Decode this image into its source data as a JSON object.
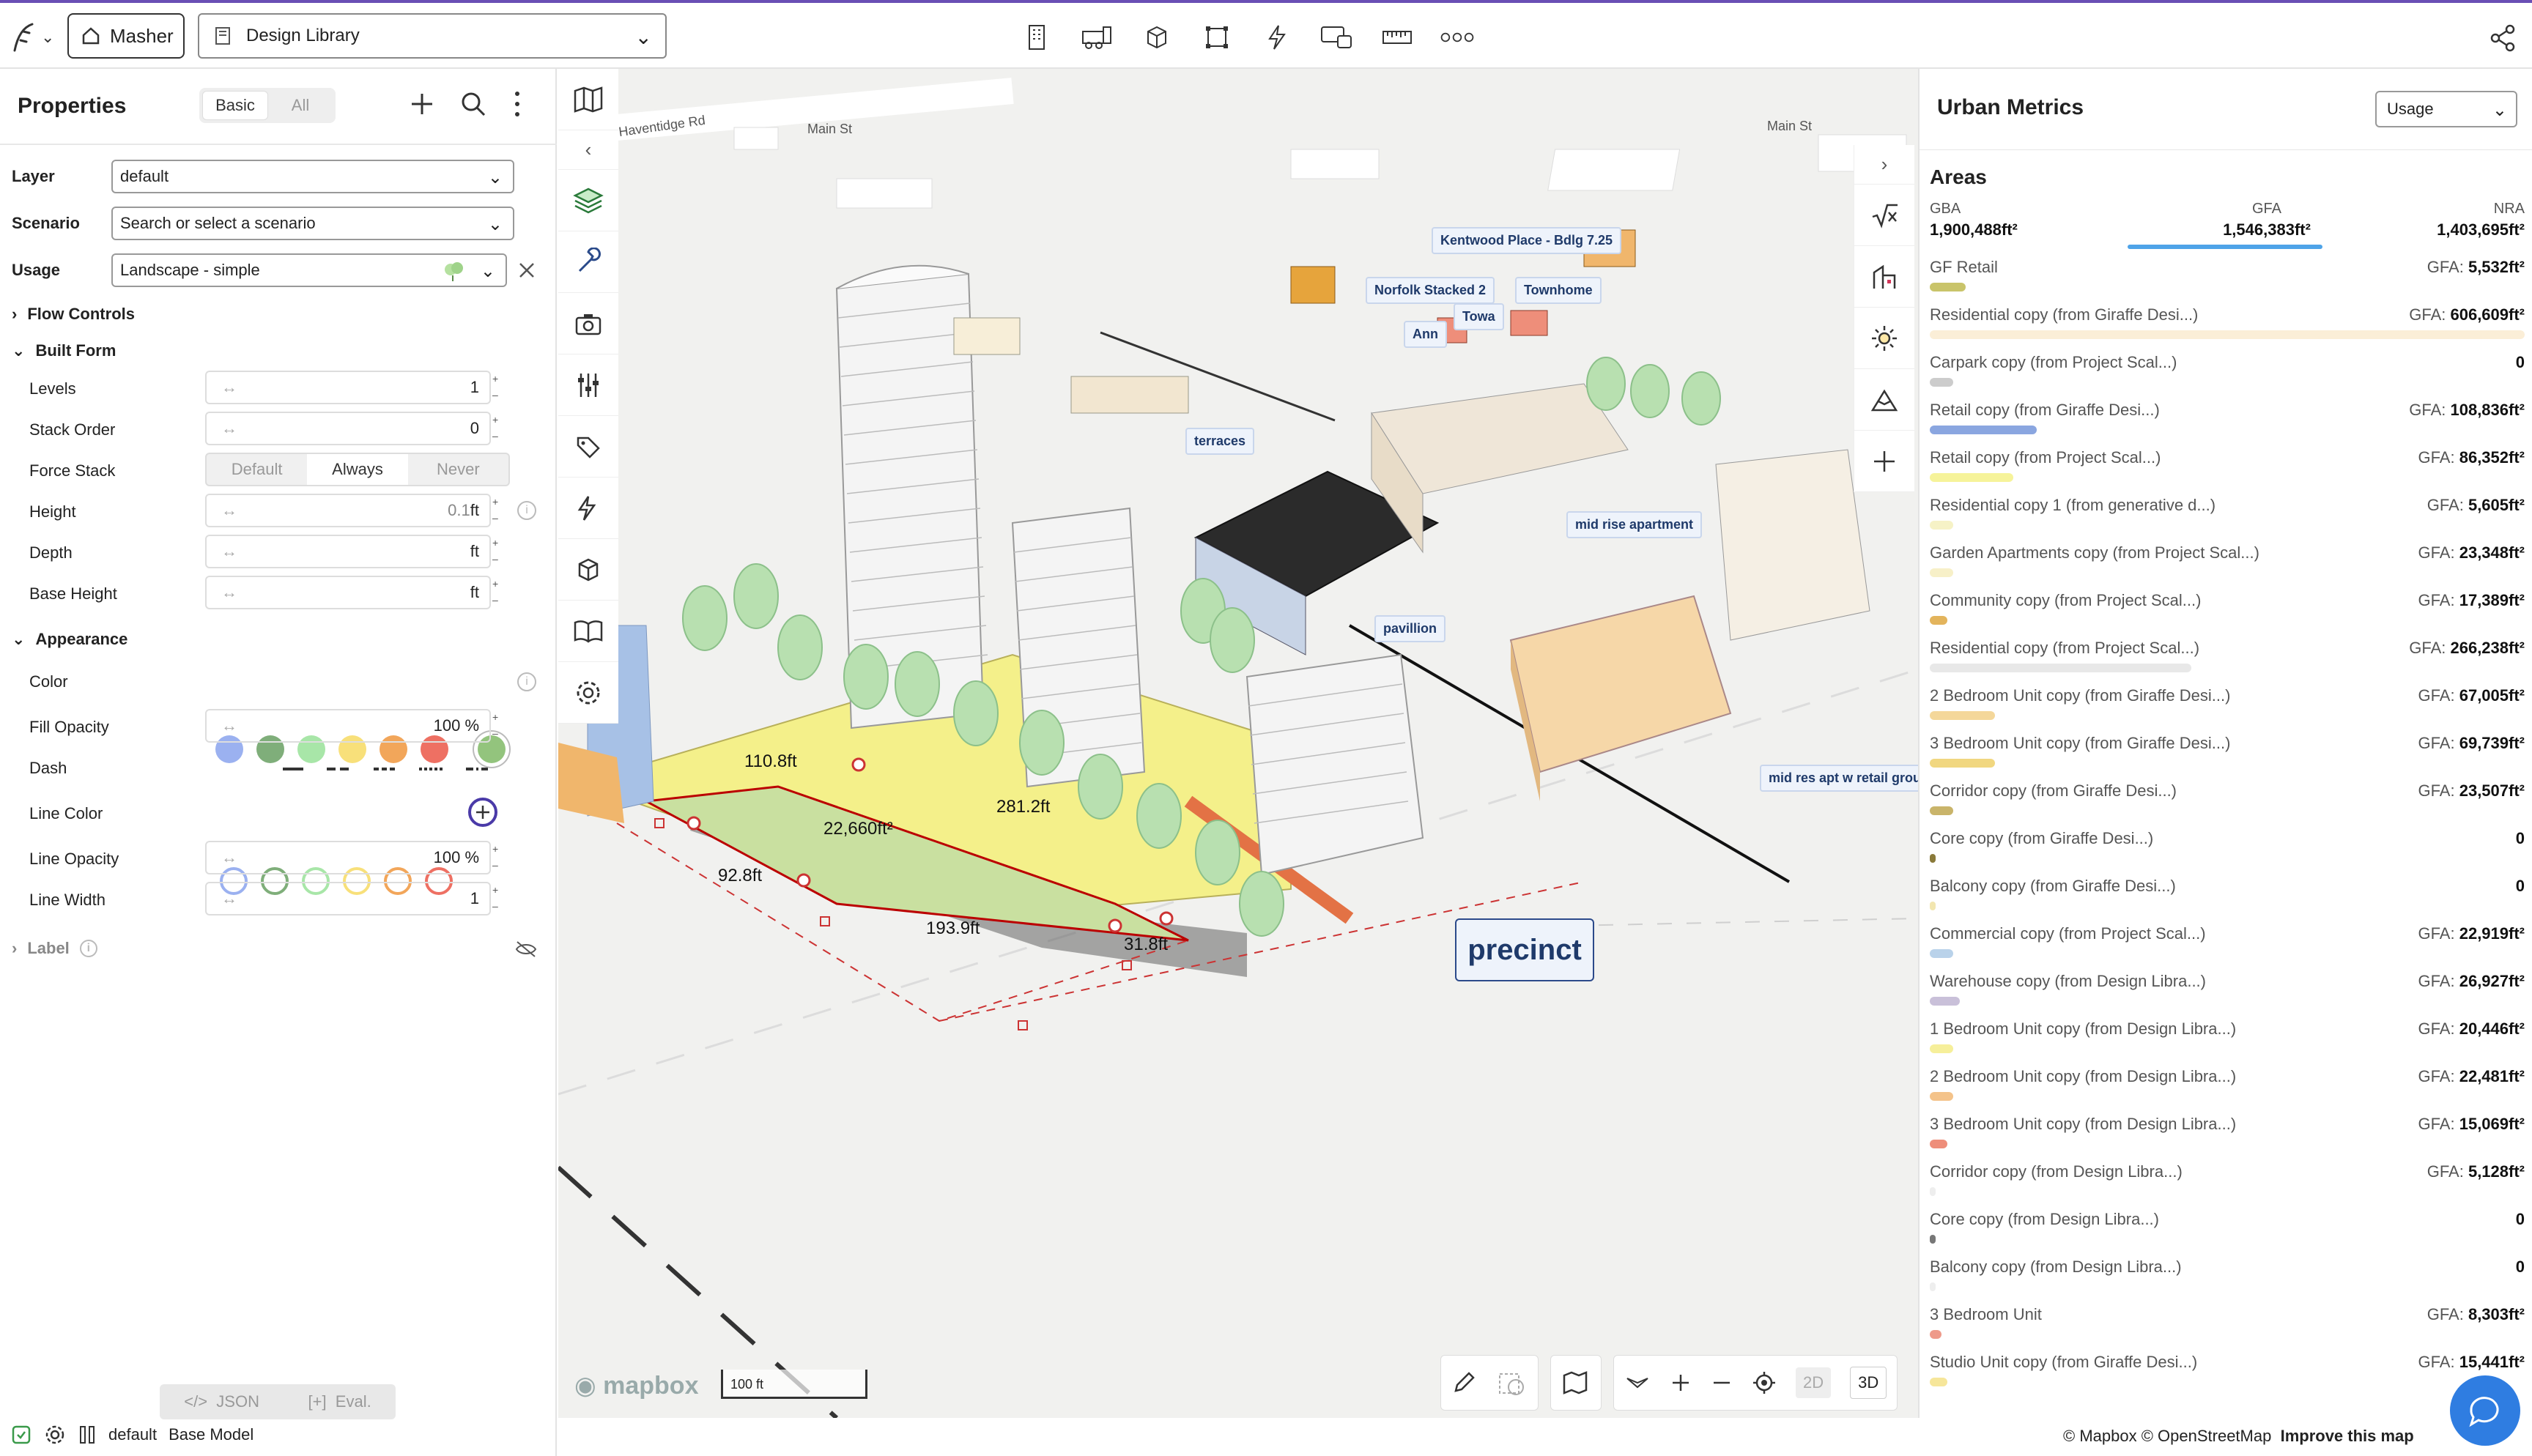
{
  "topbar": {
    "home_label": "Masher",
    "library_select": "Design Library",
    "tool_icons": [
      "building-icon",
      "vehicle-icon",
      "cube-icon",
      "frame-icon",
      "lightning-icon",
      "screens-icon",
      "ruler-icon",
      "more-icon"
    ]
  },
  "properties": {
    "title": "Properties",
    "tabs": [
      "Basic",
      "All"
    ],
    "layer_label": "Layer",
    "layer_value": "default",
    "scenario_label": "Scenario",
    "scenario_value": "Search or select a scenario",
    "usage_label": "Usage",
    "usage_value": "Landscape - simple",
    "flow_controls": "Flow Controls",
    "built_form": "Built Form",
    "levels_label": "Levels",
    "levels_value": "1",
    "stack_order_label": "Stack Order",
    "stack_order_value": "0",
    "force_stack_label": "Force Stack",
    "force_stack_options": [
      "Default",
      "Always",
      "Never"
    ],
    "height_label": "Height",
    "height_value": "0.1",
    "height_unit": "ft",
    "depth_label": "Depth",
    "depth_unit": "ft",
    "base_height_label": "Base Height",
    "base_height_unit": "ft",
    "appearance": "Appearance",
    "color_label": "Color",
    "color_swatches": [
      "#9bb1f0",
      "#7fae7a",
      "#a8e6a8",
      "#f8e07a",
      "#f2a65a",
      "#ee7063",
      "#93c47d"
    ],
    "fill_opacity_label": "Fill Opacity",
    "fill_opacity_value": "100",
    "percent_unit": "%",
    "dash_label": "Dash",
    "line_color_label": "Line Color",
    "line_color_rings": [
      "#9bb1f0",
      "#7fae7a",
      "#a8e6a8",
      "#f8e07a",
      "#f2a65a",
      "#ee7063"
    ],
    "line_opacity_label": "Line Opacity",
    "line_opacity_value": "100",
    "line_width_label": "Line Width",
    "line_width_value": "1",
    "label_section": "Label",
    "json_btn": "JSON",
    "eval_btn": "Eval.",
    "footer_default": "default",
    "footer_model": "Base Model"
  },
  "map": {
    "labels": {
      "street1": "Haventidge Rd",
      "street2": "Main St",
      "street3": "Main St",
      "kentwood": "Kentwood Place - Bdlg 7.25",
      "norfolk": "Norfolk Stacked 2",
      "townhome": "Townhome",
      "towa": "Towa",
      "ann": "Ann",
      "terraces": "terraces",
      "mid_rise": "mid rise apartment",
      "pavilion": "pavillion",
      "mid_res": "mid res apt w retail grou",
      "precinct": "precinct"
    },
    "dims": {
      "d1": "110.8ft",
      "d2": "22,660ft²",
      "d3": "281.2ft",
      "d4": "92.8ft",
      "d5": "193.9ft",
      "d6": "31.8ft"
    },
    "scale": "100 ft",
    "brand": "mapbox",
    "view_2d": "2D",
    "view_3d": "3D"
  },
  "urban_metrics": {
    "title": "Urban Metrics",
    "select": "Usage",
    "areas_title": "Areas",
    "gba_label": "GBA",
    "gba_value": "1,900,488ft²",
    "gfa_label": "GFA",
    "gfa_value": "1,546,383ft²",
    "nra_label": "NRA",
    "nra_value": "1,403,695ft²",
    "items": [
      {
        "name": "GF Retail",
        "val": "5,532ft²",
        "prefix": "GFA: ",
        "color": "#c9c46a",
        "w": 6
      },
      {
        "name": "Residential copy (from Giraffe Desi...)",
        "val": "606,609ft²",
        "prefix": "GFA: ",
        "color": "#fbeed7",
        "w": 100
      },
      {
        "name": "Carpark copy (from Project Scal...)",
        "val": "0",
        "prefix": "",
        "color": "#cccccc",
        "w": 4
      },
      {
        "name": "Retail copy (from Giraffe Desi...)",
        "val": "108,836ft²",
        "prefix": "GFA: ",
        "color": "#8aa6e0",
        "w": 18
      },
      {
        "name": "Retail copy (from Project Scal...)",
        "val": "86,352ft²",
        "prefix": "GFA: ",
        "color": "#f6f39a",
        "w": 14
      },
      {
        "name": "Residential copy 1 (from generative d...)",
        "val": "5,605ft²",
        "prefix": "GFA: ",
        "color": "#f6f2c6",
        "w": 4
      },
      {
        "name": "Garden Apartments copy (from Project Scal...)",
        "val": "23,348ft²",
        "prefix": "GFA: ",
        "color": "#f7f0c8",
        "w": 4
      },
      {
        "name": "Community copy (from Project Scal...)",
        "val": "17,389ft²",
        "prefix": "GFA: ",
        "color": "#e3b45c",
        "w": 3
      },
      {
        "name": "Residential copy (from Project Scal...)",
        "val": "266,238ft²",
        "prefix": "GFA: ",
        "color": "#e8e8e8",
        "w": 44
      },
      {
        "name": "2 Bedroom Unit copy (from Giraffe Desi...)",
        "val": "67,005ft²",
        "prefix": "GFA: ",
        "color": "#f4d79a",
        "w": 11
      },
      {
        "name": "3 Bedroom Unit copy (from Giraffe Desi...)",
        "val": "69,739ft²",
        "prefix": "GFA: ",
        "color": "#f1d780",
        "w": 11
      },
      {
        "name": "Corridor copy (from Giraffe Desi...)",
        "val": "23,507ft²",
        "prefix": "GFA: ",
        "color": "#c9b46a",
        "w": 4
      },
      {
        "name": "Core copy (from Giraffe Desi...)",
        "val": "0",
        "prefix": "",
        "color": "#8a7a3a",
        "w": 1
      },
      {
        "name": "Balcony copy (from Giraffe Desi...)",
        "val": "0",
        "prefix": "",
        "color": "#f2e6b0",
        "w": 1
      },
      {
        "name": "Commercial copy (from Project Scal...)",
        "val": "22,919ft²",
        "prefix": "GFA: ",
        "color": "#b9d2ea",
        "w": 4
      },
      {
        "name": "Warehouse copy (from Design Libra...)",
        "val": "26,927ft²",
        "prefix": "GFA: ",
        "color": "#c9c0d9",
        "w": 5
      },
      {
        "name": "1 Bedroom Unit copy (from Design Libra...)",
        "val": "20,446ft²",
        "prefix": "GFA: ",
        "color": "#f6ef9a",
        "w": 4
      },
      {
        "name": "2 Bedroom Unit copy (from Design Libra...)",
        "val": "22,481ft²",
        "prefix": "GFA: ",
        "color": "#f4c38a",
        "w": 4
      },
      {
        "name": "3 Bedroom Unit copy (from Design Libra...)",
        "val": "15,069ft²",
        "prefix": "GFA: ",
        "color": "#ee8e7a",
        "w": 3
      },
      {
        "name": "Corridor copy (from Design Libra...)",
        "val": "5,128ft²",
        "prefix": "GFA: ",
        "color": "#eeeeee",
        "w": 1
      },
      {
        "name": "Core copy (from Design Libra...)",
        "val": "0",
        "prefix": "",
        "color": "#777777",
        "w": 1
      },
      {
        "name": "Balcony copy (from Design Libra...)",
        "val": "0",
        "prefix": "",
        "color": "#eeeeee",
        "w": 1
      },
      {
        "name": "3 Bedroom Unit",
        "val": "8,303ft²",
        "prefix": "GFA: ",
        "color": "#ee9a8a",
        "w": 2
      },
      {
        "name": "Studio Unit copy (from Giraffe Desi...)",
        "val": "15,441ft²",
        "prefix": "GFA: ",
        "color": "#f6e69a",
        "w": 3
      }
    ]
  },
  "footer": {
    "attribution": "© Mapbox © OpenStreetMap",
    "improve": "Improve this map"
  }
}
